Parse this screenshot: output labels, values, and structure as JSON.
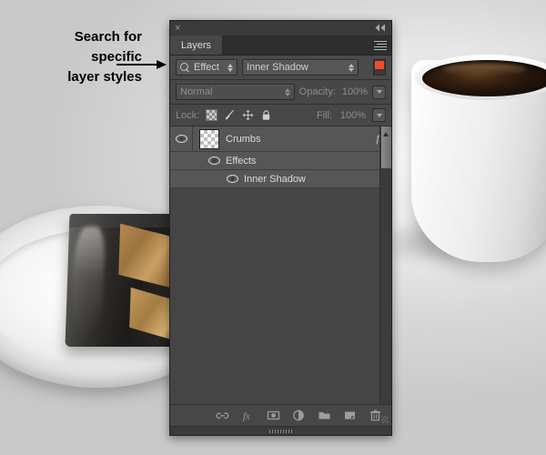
{
  "annotation": {
    "line1": "Search for",
    "line2": "specific",
    "line3": "layer styles",
    "arrow_icon": "arrow-right-icon"
  },
  "panel": {
    "close_label": "×",
    "collapse_label": "◀◀",
    "menu_icon": "panel-menu-icon",
    "tabs": [
      {
        "label": "Layers",
        "active": true
      }
    ],
    "filter": {
      "search_icon": "search-icon",
      "kind_value": "Effect",
      "effect_value": "Inner Shadow",
      "toggle_color": "#f04b33",
      "toggle_name": "filter-enable-toggle"
    },
    "blend": {
      "mode_value": "Normal",
      "opacity_label": "Opacity:",
      "opacity_value": "100%"
    },
    "lock": {
      "label": "Lock:",
      "icons": [
        "lock-transparent-pixels-icon",
        "lock-image-pixels-icon",
        "lock-position-icon",
        "lock-all-icon"
      ],
      "fill_label": "Fill:",
      "fill_value": "100%"
    },
    "layers": [
      {
        "name": "Crumbs",
        "visible": true,
        "thumbnail": "transparent-checkerboard",
        "fx_badge": "fx",
        "selected": true
      }
    ],
    "effects_group": {
      "label": "Effects",
      "visible": true,
      "children": [
        {
          "label": "Inner Shadow",
          "visible": true
        }
      ]
    },
    "bottom_toolbar": [
      "link-layers-icon",
      "add-layer-style-icon",
      "add-layer-mask-icon",
      "new-adjustment-layer-icon",
      "new-group-icon",
      "new-layer-icon",
      "delete-layer-icon"
    ],
    "scrollbar": {
      "name": "layers-scrollbar"
    },
    "resize_grip": "panel-resize-grip"
  },
  "background": {
    "description": "coffee-cup-and-cake-photo"
  }
}
